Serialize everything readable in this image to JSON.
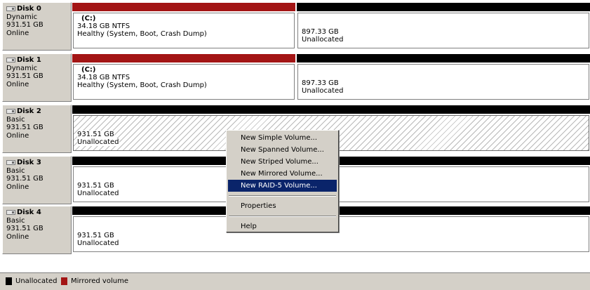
{
  "colors": {
    "unallocated_bar": "#000000",
    "mirrored_bar": "#a31515",
    "menu_highlight": "#0a246a"
  },
  "disks": [
    {
      "name": "Disk 0",
      "type": "Dynamic",
      "size": "931.51 GB",
      "status": "Online",
      "partitions": [
        {
          "kind": "mirrored",
          "volume": "(C:)",
          "size": "34.18 GB NTFS",
          "status": "Healthy (System, Boot, Crash Dump)"
        },
        {
          "kind": "unallocated",
          "size": "897.33 GB",
          "status": "Unallocated"
        }
      ]
    },
    {
      "name": "Disk 1",
      "type": "Dynamic",
      "size": "931.51 GB",
      "status": "Online",
      "partitions": [
        {
          "kind": "mirrored",
          "volume": "(C:)",
          "size": "34.18 GB NTFS",
          "status": "Healthy (System, Boot, Crash Dump)"
        },
        {
          "kind": "unallocated",
          "size": "897.33 GB",
          "status": "Unallocated"
        }
      ]
    },
    {
      "name": "Disk 2",
      "type": "Basic",
      "size": "931.51 GB",
      "status": "Online",
      "partitions": [
        {
          "kind": "unallocated",
          "selected": true,
          "size": "931.51 GB",
          "status": "Unallocated"
        }
      ]
    },
    {
      "name": "Disk 3",
      "type": "Basic",
      "size": "931.51 GB",
      "status": "Online",
      "partitions": [
        {
          "kind": "unallocated",
          "size": "931.51 GB",
          "status": "Unallocated"
        }
      ]
    },
    {
      "name": "Disk 4",
      "type": "Basic",
      "size": "931.51 GB",
      "status": "Online",
      "partitions": [
        {
          "kind": "unallocated",
          "size": "931.51 GB",
          "status": "Unallocated"
        }
      ]
    }
  ],
  "context_menu": {
    "items": [
      "New Simple Volume...",
      "New Spanned Volume...",
      "New Striped Volume...",
      "New Mirrored Volume...",
      "New RAID-5 Volume...",
      "Properties",
      "Help"
    ],
    "highlighted_item": "New RAID-5 Volume..."
  },
  "legend": {
    "unallocated": "Unallocated",
    "mirrored": "Mirrored volume"
  }
}
